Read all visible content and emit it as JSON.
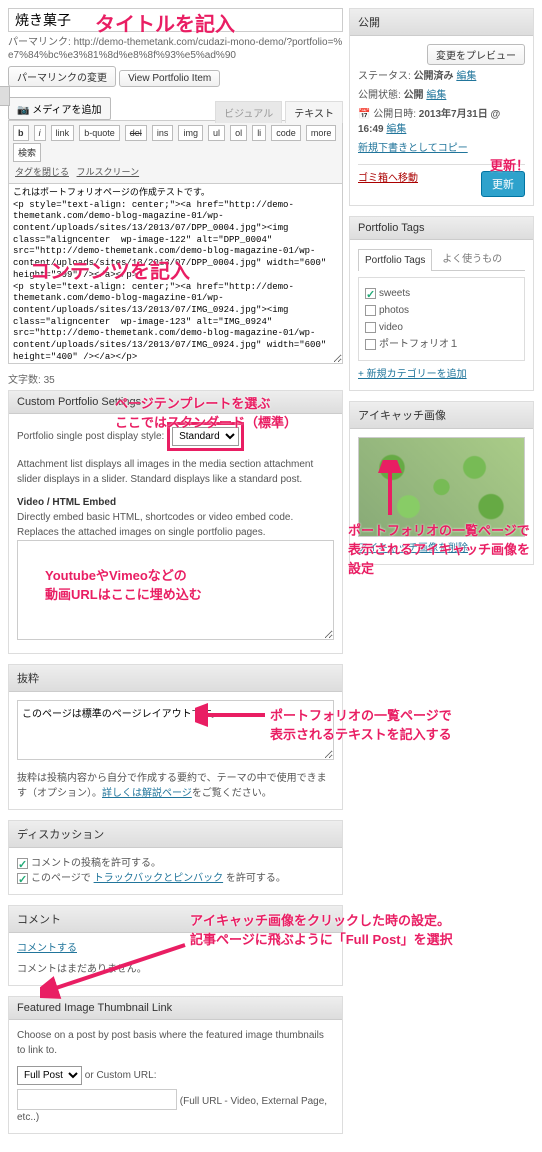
{
  "title_value": "焼き菓子",
  "permalink": {
    "label": "パーマリンク:",
    "url": "http://demo-themetank.com/cudazi-mono-demo/?portfolio=%e7%84%bc%e3%81%8d%e8%8f%93%e5%ad%90",
    "edit_btn": "パーマリンクの変更",
    "view_btn": "View Portfolio Item"
  },
  "media_btn": "メディアを追加",
  "tabs": {
    "visual": "ビジュアル",
    "text": "テキスト"
  },
  "toolbar": {
    "b": "b",
    "i": "i",
    "link": "link",
    "bquote": "b-quote",
    "del": "del",
    "ins": "ins",
    "img": "img",
    "ul": "ul",
    "ol": "ol",
    "li": "li",
    "code": "code",
    "more": "more",
    "search": "検索",
    "close_tags": "タグを閉じる",
    "fullscreen": "フルスクリーン"
  },
  "editor_content": "これはポートフォリオページの作成テストです。\n<p style=\"text-align: center;\"><a href=\"http://demo-themetank.com/demo-blog-magazine-01/wp-content/uploads/sites/13/2013/07/DPP_0004.jpg\"><img class=\"aligncenter  wp-image-122\" alt=\"DPP_0004\" src=\"http://demo-themetank.com/demo-blog-magazine-01/wp-content/uploads/sites/13/2013/07/DPP_0004.jpg\" width=\"600\" height=\"399\" /></a></p>\n<p style=\"text-align: center;\"><a href=\"http://demo-themetank.com/demo-blog-magazine-01/wp-content/uploads/sites/13/2013/07/IMG_0924.jpg\"><img class=\"aligncenter  wp-image-123\" alt=\"IMG_0924\" src=\"http://demo-themetank.com/demo-blog-magazine-01/wp-content/uploads/sites/13/2013/07/IMG_0924.jpg\" width=\"600\" height=\"400\" /></a></p>",
  "word_count": {
    "label": "文字数:",
    "value": "35"
  },
  "cps": {
    "title": "Custom Portfolio Settings",
    "style_label": "Portfolio single post display style:",
    "style_value": "Standard",
    "desc": "Attachment list displays all images in the media section attachment slider displays in a slider. Standard displays like a standard post.",
    "embed_h": "Video / HTML Embed",
    "embed_desc": "Directly embed basic HTML, shortcodes or video embed code. Replaces the attached images on single portfolio pages."
  },
  "excerpt": {
    "title": "抜粋",
    "value": "このページは標準のページレイアウトです。",
    "help1": "抜粋は投稿内容から自分で作成する要約で、テーマの中で使用できます（オプション）。",
    "help_link": "詳しくは解説ページ",
    "help2": "をご覧ください。"
  },
  "discussion": {
    "title": "ディスカッション",
    "allow_comments": "コメントの投稿を許可する。",
    "allow_ping": "このページで ",
    "ping_link": "トラックバックとピンバック",
    "ping_tail": " を許可する。"
  },
  "comments": {
    "title": "コメント",
    "add": "コメントする",
    "none": "コメントはまだありません。"
  },
  "fitl": {
    "title": "Featured Image Thumbnail Link",
    "desc": "Choose on a post by post basis where the featured image thumbnails to link to.",
    "select": "Full Post",
    "or": "or Custom URL:",
    "hint": "(Full URL - Video, External Page, etc..)"
  },
  "publish": {
    "title": "公開",
    "preview": "変更をプレビュー",
    "status_l": "ステータス:",
    "status_v": "公開済み",
    "edit": "編集",
    "visibility_l": "公開状態:",
    "visibility_v": "公開",
    "date_l": "公開日時:",
    "date_v": "2013年7月31日 @ 16:49",
    "copy_draft": "新規下書きとしてコピー",
    "trash": "ゴミ箱へ移動",
    "update": "更新"
  },
  "tags": {
    "title": "Portfolio Tags",
    "tab_all": "Portfolio Tags",
    "tab_used": "よく使うもの",
    "items": [
      {
        "label": "sweets",
        "checked": true
      },
      {
        "label": "photos",
        "checked": false
      },
      {
        "label": "video",
        "checked": false
      },
      {
        "label": "ポートフォリオ１",
        "checked": false
      }
    ],
    "add_new": "+ 新規カテゴリーを追加"
  },
  "featured": {
    "title": "アイキャッチ画像",
    "remove": "アイキャッチ画像を削除"
  },
  "anno": {
    "title": "タイトルを記入",
    "content": "コンテンツを記入",
    "tpl1": "ページテンプレートを選ぶ",
    "tpl2": "ここではスタンダード（標準）",
    "embed1": "YoutubeやVimeoなどの",
    "embed2": "動画URLはここに埋め込む",
    "excerpt1": "ポートフォリオの一覧ページで",
    "excerpt2": "表示されるテキストを記入する",
    "thumb1": "ポートフォリオの一覧ページで",
    "thumb2": "表示されるアイキャッチ画像を設定",
    "fitl1": "アイキャッチ画像をクリックした時の設定。",
    "fitl2": "記事ページに飛ぶように「Full Post」を選択",
    "update": "更新！"
  }
}
